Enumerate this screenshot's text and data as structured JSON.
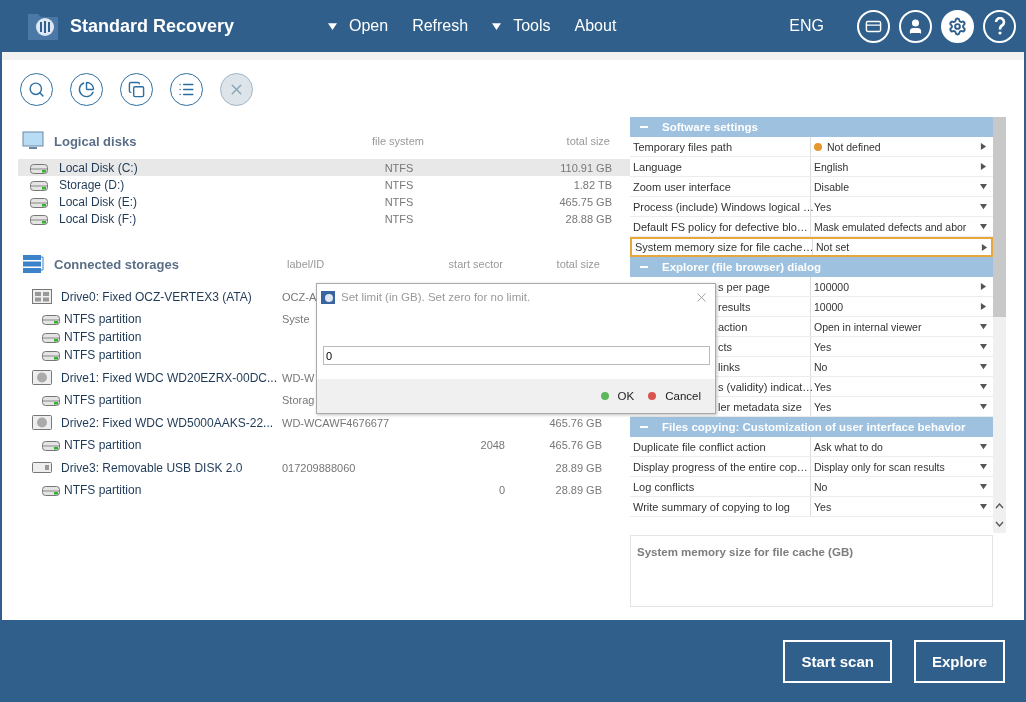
{
  "app": {
    "title": "Standard Recovery"
  },
  "menu": [
    {
      "label": "Open",
      "dropdown": true
    },
    {
      "label": "Refresh",
      "dropdown": false
    },
    {
      "label": "Tools",
      "dropdown": true
    },
    {
      "label": "About",
      "dropdown": false
    }
  ],
  "language": "ENG",
  "header_buttons": [
    {
      "kind": "card",
      "selected": false
    },
    {
      "kind": "user",
      "selected": false
    },
    {
      "kind": "settings",
      "selected": true
    },
    {
      "kind": "help",
      "selected": false
    }
  ],
  "toolbar": [
    {
      "kind": "search",
      "disabled": false
    },
    {
      "kind": "chart",
      "disabled": false
    },
    {
      "kind": "copy",
      "disabled": false
    },
    {
      "kind": "list",
      "disabled": false
    },
    {
      "kind": "close",
      "disabled": true
    }
  ],
  "logical_disks": {
    "title": "Logical disks",
    "columns": [
      "file system",
      "total size"
    ],
    "rows": [
      {
        "name": "Local Disk (C:)",
        "fs": "NTFS",
        "size": "110.91 GB",
        "selected": true
      },
      {
        "name": "Storage (D:)",
        "fs": "NTFS",
        "size": "1.82 TB",
        "selected": false
      },
      {
        "name": "Local Disk (E:)",
        "fs": "NTFS",
        "size": "465.75 GB",
        "selected": false
      },
      {
        "name": "Local Disk (F:)",
        "fs": "NTFS",
        "size": "28.88 GB",
        "selected": false
      }
    ]
  },
  "storages": {
    "title": "Connected storages",
    "columns": [
      "label/ID",
      "start sector",
      "total size"
    ],
    "rows": [
      {
        "kind": "ssd",
        "name": "Drive0: Fixed OCZ-VERTEX3 (ATA)",
        "label": "OCZ-A"
      },
      {
        "kind": "partition",
        "name": "NTFS partition",
        "label": "Syste"
      },
      {
        "kind": "partition",
        "name": "NTFS partition"
      },
      {
        "kind": "partition",
        "name": "NTFS partition"
      },
      {
        "kind": "hdd",
        "name": "Drive1: Fixed WDC WD20EZRX-00DC...",
        "label": "WD-W"
      },
      {
        "kind": "partition",
        "name": "NTFS partition",
        "label": "Storag"
      },
      {
        "kind": "hdd",
        "name": "Drive2: Fixed WDC WD5000AAKS-22...",
        "label": "WD-WCAWF4676677",
        "size": "465.76 GB"
      },
      {
        "kind": "partition",
        "name": "NTFS partition",
        "sector": "2048",
        "size": "465.76 GB"
      },
      {
        "kind": "usb",
        "name": "Drive3: Removable USB DISK 2.0",
        "label": "017209888060",
        "size": "28.89 GB"
      },
      {
        "kind": "partition",
        "name": "NTFS partition",
        "sector": "0",
        "size": "28.89 GB"
      }
    ]
  },
  "settings": [
    {
      "kind": "section",
      "label": "Software settings",
      "expanded": true
    },
    {
      "kind": "row",
      "label": "Temporary files path",
      "value": "Not defined",
      "color": "#e8962e",
      "dropdown": false,
      "selected": false
    },
    {
      "kind": "row",
      "label": "Language",
      "value": "English",
      "dropdown": false,
      "selected": false
    },
    {
      "kind": "row",
      "label": "Zoom user interface",
      "value": "Disable",
      "dropdown": true,
      "selected": false
    },
    {
      "kind": "row",
      "label": "Process (include) Windows logical …",
      "value": "Yes",
      "dropdown": true,
      "selected": false
    },
    {
      "kind": "row",
      "label": "Default FS policy for defective blo…",
      "value": "Mask emulated defects and abor",
      "dropdown": true,
      "selected": false
    },
    {
      "kind": "row",
      "label": "System memory size for file cache…",
      "value": "Not set",
      "dropdown": false,
      "selected": true
    },
    {
      "kind": "section",
      "label": "Explorer (file browser) dialog",
      "expanded": true
    },
    {
      "kind": "row",
      "label": "s per page",
      "covered": true,
      "value": "100000",
      "dropdown": false,
      "selected": false
    },
    {
      "kind": "row",
      "label": "results",
      "covered": true,
      "value": "10000",
      "dropdown": false,
      "selected": false
    },
    {
      "kind": "row",
      "label": "action",
      "covered": true,
      "value": "Open in internal viewer",
      "dropdown": true,
      "selected": false
    },
    {
      "kind": "row",
      "label": "cts",
      "covered": true,
      "value": "Yes",
      "dropdown": true,
      "selected": false
    },
    {
      "kind": "row",
      "label": "links",
      "covered": true,
      "value": "No",
      "dropdown": true,
      "selected": false
    },
    {
      "kind": "row",
      "label": "s (validity) indicat…",
      "covered": true,
      "value": "Yes",
      "dropdown": true,
      "selected": false
    },
    {
      "kind": "row",
      "label": "ler metadata size",
      "covered": true,
      "value": "Yes",
      "dropdown": true,
      "selected": false
    },
    {
      "kind": "section",
      "label": "Files copying: Customization of user interface behavior",
      "expanded": true
    },
    {
      "kind": "row",
      "label": "Duplicate file conflict action",
      "value": "Ask what to do",
      "dropdown": true,
      "selected": false
    },
    {
      "kind": "row",
      "label": "Display progress of the entire cop…",
      "value": "Display only for scan results",
      "dropdown": true,
      "selected": false
    },
    {
      "kind": "row",
      "label": "Log conflicts",
      "value": "No",
      "dropdown": true,
      "selected": false
    },
    {
      "kind": "row",
      "label": "Write summary of copying to log",
      "value": "Yes",
      "dropdown": true,
      "selected": false
    }
  ],
  "description": "System memory size for file cache (GB)",
  "dialog": {
    "title": "Set limit (in GB). Set zero for no limit.",
    "value": "0",
    "buttons": [
      {
        "label": "OK",
        "color": "#5cb85c"
      },
      {
        "label": "Cancel",
        "color": "#d9534f"
      }
    ]
  },
  "footer_buttons": [
    "Start scan",
    "Explore"
  ]
}
